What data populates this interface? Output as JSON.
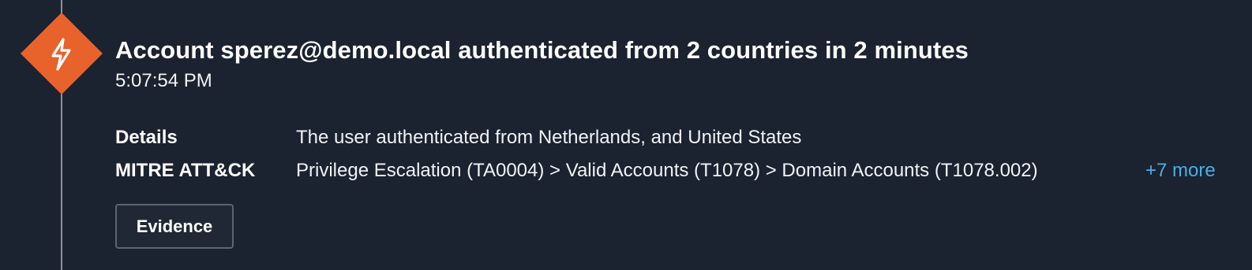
{
  "alert": {
    "icon": "lightning-bolt-icon",
    "badge_color": "#e8622b",
    "title": "Account sperez@demo.local authenticated from 2 countries in 2 minutes",
    "time": "5:07:54 PM",
    "details_label": "Details",
    "details_value": "The user authenticated from Netherlands, and United States",
    "mitre_label": "MITRE ATT&CK",
    "mitre_value": "Privilege Escalation (TA0004) > Valid Accounts (T1078) > Domain Accounts (T1078.002)",
    "mitre_more": "+7 more",
    "evidence_label": "Evidence"
  }
}
